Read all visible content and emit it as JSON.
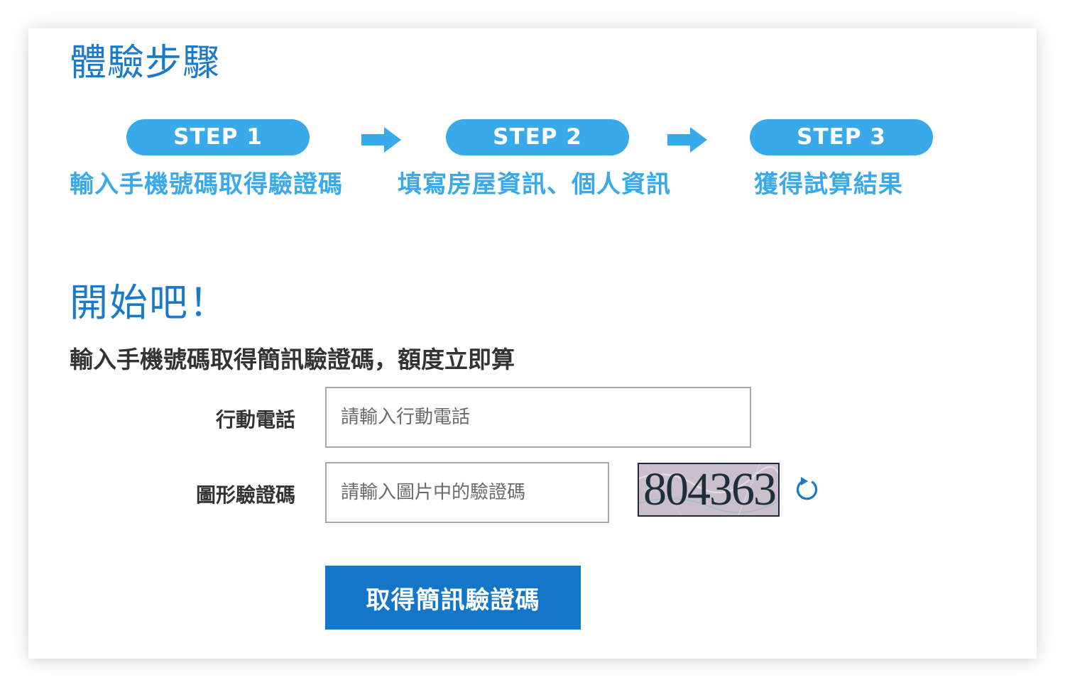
{
  "steps_section": {
    "title": "體驗步驟",
    "steps": [
      {
        "label": "STEP 1",
        "desc": "輸入手機號碼取得驗證碼"
      },
      {
        "label": "STEP 2",
        "desc": "填寫房屋資訊、個人資訊"
      },
      {
        "label": "STEP 3",
        "desc": "獲得試算結果"
      }
    ]
  },
  "start_section": {
    "title": "開始吧！",
    "subtitle": "輸入手機號碼取得簡訊驗證碼，額度立即算"
  },
  "form": {
    "phone": {
      "label": "行動電話",
      "placeholder": "請輸入行動電話",
      "value": ""
    },
    "captcha": {
      "label": "圖形驗證碼",
      "placeholder": "請輸入圖片中的驗證碼",
      "value": "",
      "image_text": "804363"
    },
    "submit_label": "取得簡訊驗證碼"
  },
  "colors": {
    "title_blue": "#1a7ac9",
    "step_blue": "#3aa9ea",
    "button_blue": "#1376c9"
  },
  "icons": {
    "arrow": "arrow-right-icon",
    "refresh": "refresh-icon"
  }
}
